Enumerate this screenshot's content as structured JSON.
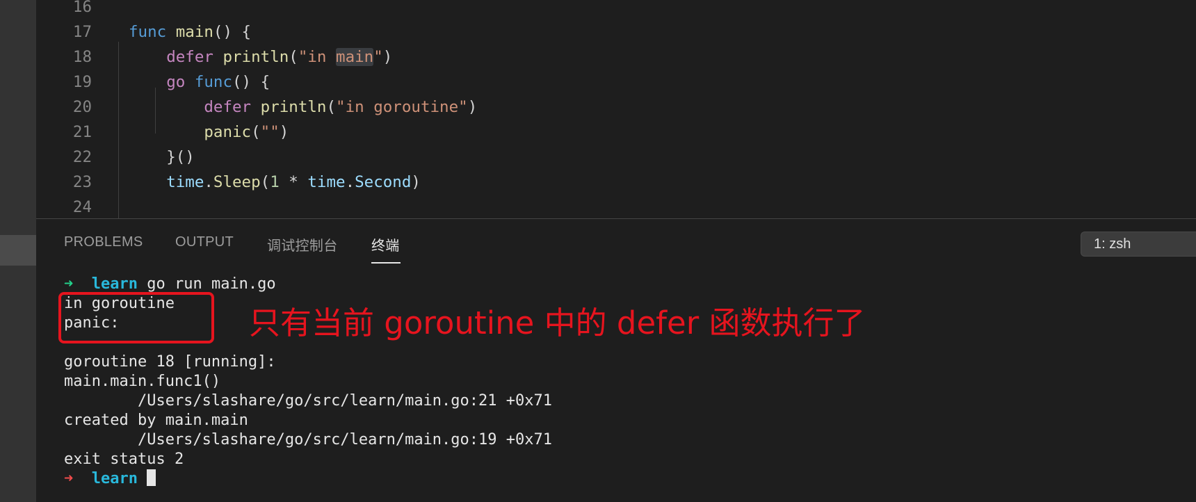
{
  "editor": {
    "lines": [
      {
        "num": "16",
        "tokens": []
      },
      {
        "num": "17",
        "tokens": [
          {
            "t": "func",
            "c": "kw-blue"
          },
          {
            "t": " "
          },
          {
            "t": "main",
            "c": "fn"
          },
          {
            "t": "() {"
          }
        ]
      },
      {
        "num": "18",
        "tokens": [
          {
            "t": "    "
          },
          {
            "t": "defer",
            "c": "kw-pink"
          },
          {
            "t": " "
          },
          {
            "t": "println",
            "c": "fn"
          },
          {
            "t": "("
          },
          {
            "t": "\"in ",
            "c": "str"
          },
          {
            "t": "main",
            "c": "str hl"
          },
          {
            "t": "\"",
            "c": "str"
          },
          {
            "t": ")"
          }
        ]
      },
      {
        "num": "19",
        "tokens": [
          {
            "t": "    "
          },
          {
            "t": "go",
            "c": "kw-pink"
          },
          {
            "t": " "
          },
          {
            "t": "func",
            "c": "kw-blue"
          },
          {
            "t": "() {"
          }
        ]
      },
      {
        "num": "20",
        "tokens": [
          {
            "t": "        "
          },
          {
            "t": "defer",
            "c": "kw-pink"
          },
          {
            "t": " "
          },
          {
            "t": "println",
            "c": "fn"
          },
          {
            "t": "("
          },
          {
            "t": "\"in goroutine\"",
            "c": "str"
          },
          {
            "t": ")"
          }
        ]
      },
      {
        "num": "21",
        "tokens": [
          {
            "t": "        "
          },
          {
            "t": "panic",
            "c": "fn"
          },
          {
            "t": "("
          },
          {
            "t": "\"\"",
            "c": "str"
          },
          {
            "t": ")"
          }
        ]
      },
      {
        "num": "22",
        "tokens": [
          {
            "t": "    "
          },
          {
            "t": "}()"
          }
        ]
      },
      {
        "num": "23",
        "tokens": [
          {
            "t": "    "
          },
          {
            "t": "time",
            "c": "var"
          },
          {
            "t": "."
          },
          {
            "t": "Sleep",
            "c": "fn"
          },
          {
            "t": "("
          },
          {
            "t": "1",
            "c": "num"
          },
          {
            "t": " * "
          },
          {
            "t": "time",
            "c": "var"
          },
          {
            "t": "."
          },
          {
            "t": "Second",
            "c": "var"
          },
          {
            "t": ")"
          }
        ]
      },
      {
        "num": "24",
        "tokens": []
      }
    ]
  },
  "panel": {
    "tabs": [
      {
        "label": "PROBLEMS",
        "active": false
      },
      {
        "label": "OUTPUT",
        "active": false
      },
      {
        "label": "调试控制台",
        "active": false
      },
      {
        "label": "终端",
        "active": true
      }
    ],
    "terminal_select": "1: zsh"
  },
  "terminal": {
    "prompt_dir": "learn",
    "prompt_arrow": "➜",
    "command": "go run main.go",
    "output": [
      "in goroutine",
      "panic:",
      "",
      "goroutine 18 [running]:",
      "main.main.func1()",
      "        /Users/slashare/go/src/learn/main.go:21 +0x71",
      "created by main.main",
      "        /Users/slashare/go/src/learn/main.go:19 +0x71",
      "exit status 2"
    ]
  },
  "annotation": {
    "text": "只有当前 goroutine 中的 defer 函数执行了",
    "color": "#e6141e"
  }
}
